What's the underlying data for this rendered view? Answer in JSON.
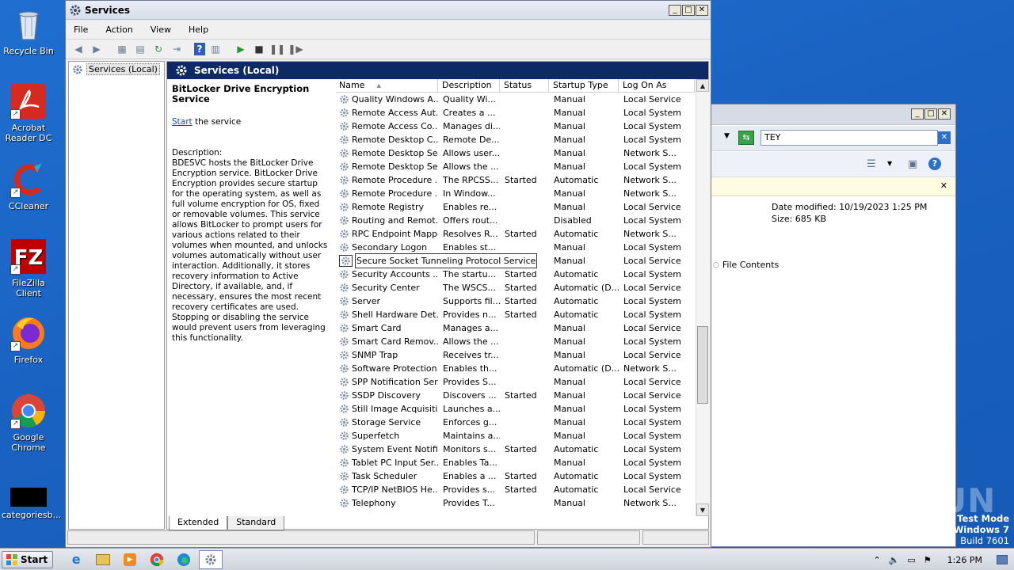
{
  "desktop": {
    "icons": [
      {
        "label": "Recycle Bin"
      },
      {
        "label": "Acrobat Reader DC"
      },
      {
        "label": "CCleaner"
      },
      {
        "label": "FileZilla Client"
      },
      {
        "label": "Firefox"
      },
      {
        "label": "Google Chrome"
      },
      {
        "label": "categoriesb..."
      }
    ]
  },
  "explorer": {
    "search_value": "TEY",
    "date_modified": "Date modified: 10/19/2023 1:25 PM",
    "size": "Size: 685 KB",
    "file_contents": "File Contents"
  },
  "services": {
    "title": "Services",
    "menu": [
      "File",
      "Action",
      "View",
      "Help"
    ],
    "tree_item": "Services (Local)",
    "header": "Services (Local)",
    "selected_service_name": "BitLocker Drive Encryption Service",
    "start_link": "Start",
    "start_suffix": " the service",
    "description_label": "Description:",
    "description": "BDESVC hosts the BitLocker Drive Encryption service. BitLocker Drive Encryption provides secure startup for the operating system, as well as full volume encryption for OS, fixed or removable volumes. This service allows BitLocker to prompt users for various actions related to their volumes when mounted, and unlocks volumes automatically without user interaction. Additionally, it stores recovery information to Active Directory, if available, and, if necessary, ensures the most recent recovery certificates are used.  Stopping or disabling the service would prevent users from leveraging this functionality.",
    "columns": {
      "name": "Name",
      "description": "Description",
      "status": "Status",
      "startup": "Startup Type",
      "logon": "Log On As"
    },
    "rows": [
      {
        "name": "Quality Windows A...",
        "desc": "Quality Wi...",
        "status": "",
        "startup": "Manual",
        "logon": "Local Service"
      },
      {
        "name": "Remote Access Aut...",
        "desc": "Creates a ...",
        "status": "",
        "startup": "Manual",
        "logon": "Local System"
      },
      {
        "name": "Remote Access Co...",
        "desc": "Manages di...",
        "status": "",
        "startup": "Manual",
        "logon": "Local System"
      },
      {
        "name": "Remote Desktop C...",
        "desc": "Remote De...",
        "status": "",
        "startup": "Manual",
        "logon": "Local System"
      },
      {
        "name": "Remote Desktop Se...",
        "desc": "Allows user...",
        "status": "",
        "startup": "Manual",
        "logon": "Network S..."
      },
      {
        "name": "Remote Desktop Se...",
        "desc": "Allows the ...",
        "status": "",
        "startup": "Manual",
        "logon": "Local System"
      },
      {
        "name": "Remote Procedure ...",
        "desc": "The RPCSS...",
        "status": "Started",
        "startup": "Automatic",
        "logon": "Network S..."
      },
      {
        "name": "Remote Procedure ...",
        "desc": "In Window...",
        "status": "",
        "startup": "Manual",
        "logon": "Network S..."
      },
      {
        "name": "Remote Registry",
        "desc": "Enables re...",
        "status": "",
        "startup": "Manual",
        "logon": "Local Service"
      },
      {
        "name": "Routing and Remot...",
        "desc": "Offers rout...",
        "status": "",
        "startup": "Disabled",
        "logon": "Local System"
      },
      {
        "name": "RPC Endpoint Mapper",
        "desc": "Resolves R...",
        "status": "Started",
        "startup": "Automatic",
        "logon": "Network S..."
      },
      {
        "name": "Secondary Logon",
        "desc": "Enables st...",
        "status": "",
        "startup": "Manual",
        "logon": "Local System"
      },
      {
        "name": "Secure Socket Tunneling Protocol Service",
        "desc": "",
        "status": "",
        "startup": "Manual",
        "logon": "Local Service",
        "selected": true
      },
      {
        "name": "Security Accounts ...",
        "desc": "The startu...",
        "status": "Started",
        "startup": "Automatic",
        "logon": "Local System"
      },
      {
        "name": "Security Center",
        "desc": "The WSCS...",
        "status": "Started",
        "startup": "Automatic (D...",
        "logon": "Local Service"
      },
      {
        "name": "Server",
        "desc": "Supports fil...",
        "status": "Started",
        "startup": "Automatic",
        "logon": "Local System"
      },
      {
        "name": "Shell Hardware Det...",
        "desc": "Provides n...",
        "status": "Started",
        "startup": "Automatic",
        "logon": "Local System"
      },
      {
        "name": "Smart Card",
        "desc": "Manages a...",
        "status": "",
        "startup": "Manual",
        "logon": "Local Service"
      },
      {
        "name": "Smart Card Remov...",
        "desc": "Allows the ...",
        "status": "",
        "startup": "Manual",
        "logon": "Local System"
      },
      {
        "name": "SNMP Trap",
        "desc": "Receives tr...",
        "status": "",
        "startup": "Manual",
        "logon": "Local Service"
      },
      {
        "name": "Software Protection",
        "desc": "Enables th...",
        "status": "",
        "startup": "Automatic (D...",
        "logon": "Network S..."
      },
      {
        "name": "SPP Notification Ser...",
        "desc": "Provides S...",
        "status": "",
        "startup": "Manual",
        "logon": "Local Service"
      },
      {
        "name": "SSDP Discovery",
        "desc": "Discovers ...",
        "status": "Started",
        "startup": "Manual",
        "logon": "Local Service"
      },
      {
        "name": "Still Image Acquisiti...",
        "desc": "Launches a...",
        "status": "",
        "startup": "Manual",
        "logon": "Local System"
      },
      {
        "name": "Storage Service",
        "desc": "Enforces g...",
        "status": "",
        "startup": "Manual",
        "logon": "Local System"
      },
      {
        "name": "Superfetch",
        "desc": "Maintains a...",
        "status": "",
        "startup": "Manual",
        "logon": "Local System"
      },
      {
        "name": "System Event Notifi...",
        "desc": "Monitors s...",
        "status": "Started",
        "startup": "Automatic",
        "logon": "Local System"
      },
      {
        "name": "Tablet PC Input Ser...",
        "desc": "Enables Ta...",
        "status": "",
        "startup": "Manual",
        "logon": "Local System"
      },
      {
        "name": "Task Scheduler",
        "desc": "Enables a ...",
        "status": "Started",
        "startup": "Automatic",
        "logon": "Local System"
      },
      {
        "name": "TCP/IP NetBIOS He...",
        "desc": "Provides s...",
        "status": "Started",
        "startup": "Automatic",
        "logon": "Local Service"
      },
      {
        "name": "Telephony",
        "desc": "Provides T...",
        "status": "",
        "startup": "Manual",
        "logon": "Network S..."
      }
    ],
    "tabs": [
      "Extended",
      "Standard"
    ]
  },
  "taskbar": {
    "start_label": "Start",
    "clock": "1:26 PM"
  },
  "watermark": "ANY RUN",
  "test_mode": {
    "line1": "Test Mode",
    "line2": "Windows 7",
    "line3": "Build 7601"
  }
}
